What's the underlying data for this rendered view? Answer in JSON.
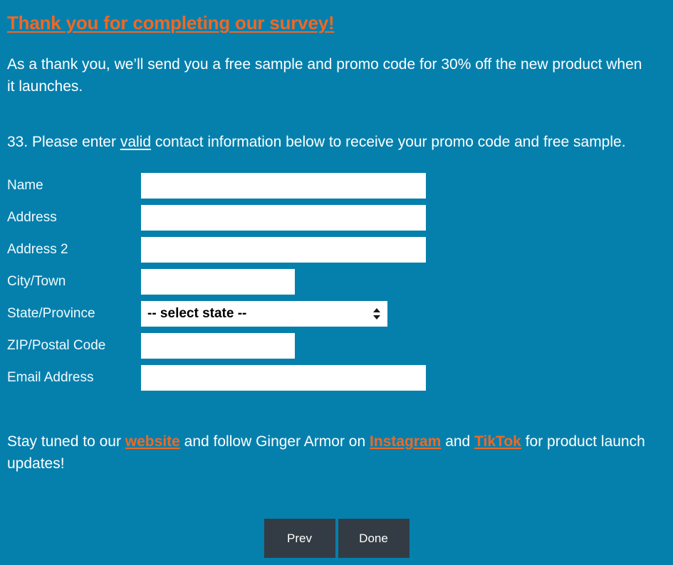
{
  "colors": {
    "background": "#0580ad",
    "accent_orange": "#f26722",
    "text_white": "#ffffff",
    "button_dark": "#333c44",
    "field_white": "#ffffff"
  },
  "heading": {
    "text": "Thank you for completing our survey!"
  },
  "intro": {
    "text": "As a thank you, we’ll send you a free sample and promo code for 30% off the new product when it launches."
  },
  "question": {
    "number": "33.",
    "part1": "Please enter",
    "emphasis": "valid",
    "part2": "contact information below to receive your promo code and free sample."
  },
  "form": {
    "fields": [
      {
        "label": "Name",
        "type": "text",
        "value": "",
        "placeholder": "",
        "width": "wide"
      },
      {
        "label": "Address",
        "type": "text",
        "value": "",
        "placeholder": "",
        "width": "wide"
      },
      {
        "label": "Address 2",
        "type": "text",
        "value": "",
        "placeholder": "",
        "width": "wide"
      },
      {
        "label": "City/Town",
        "type": "text",
        "value": "",
        "placeholder": "",
        "width": "narrow"
      },
      {
        "label": "State/Province",
        "type": "select",
        "value": "-- select state --",
        "placeholder": "",
        "width": "select"
      },
      {
        "label": "ZIP/Postal Code",
        "type": "text",
        "value": "",
        "placeholder": "",
        "width": "narrow"
      },
      {
        "label": "Email Address",
        "type": "text",
        "value": "",
        "placeholder": "",
        "width": "wide"
      }
    ],
    "state_select": {
      "selected": "-- select state --",
      "options": [
        "-- select state --"
      ],
      "arrow_icon": "select-updown-arrow-icon"
    }
  },
  "outro": {
    "part1": "Stay tuned to our",
    "link_website": "website",
    "part2": "and follow Ginger Armor on",
    "link_instagram": "Instagram",
    "part3": "and",
    "link_tiktok": "TikTok",
    "part4": "for product launch updates!"
  },
  "buttons": {
    "prev": "Prev",
    "done": "Done"
  }
}
